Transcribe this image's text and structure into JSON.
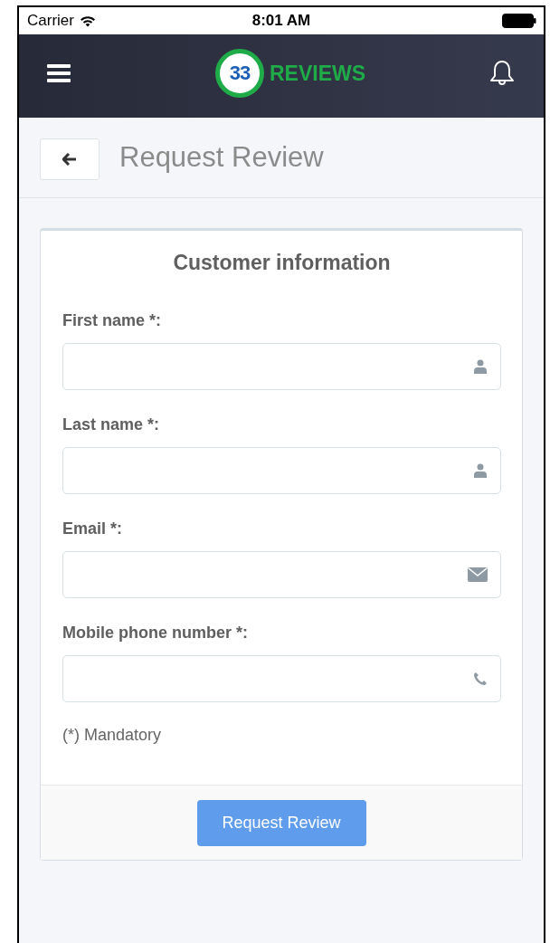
{
  "status_bar": {
    "carrier": "Carrier",
    "time": "8:01 AM"
  },
  "nav": {
    "logo_number": "33",
    "logo_text": "REVIEWS"
  },
  "header": {
    "title": "Request Review"
  },
  "card": {
    "title": "Customer information",
    "fields": [
      {
        "label": "First name *:",
        "kind": "person"
      },
      {
        "label": "Last name *:",
        "kind": "person"
      },
      {
        "label": "Email *:",
        "kind": "email"
      },
      {
        "label": "Mobile phone number *:",
        "kind": "phone"
      }
    ],
    "note": "(*) Mandatory",
    "button": "Request Review"
  }
}
